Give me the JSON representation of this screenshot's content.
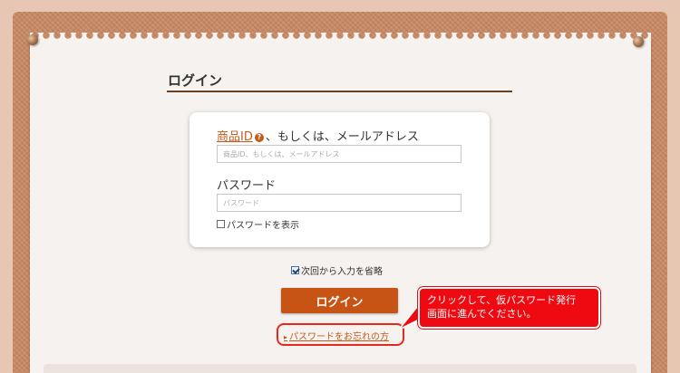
{
  "page": {
    "title": "ログイン"
  },
  "form": {
    "id_label_link": "商品ID",
    "id_help_glyph": "?",
    "id_label_rest": "、もしくは、メールアドレス",
    "id_placeholder": "商品ID、もしくは、メールアドレス",
    "password_label": "パスワード",
    "password_placeholder": "パスワード",
    "show_password_label": "パスワードを表示",
    "show_password_checked": false,
    "remember_label": "次回から入力を省略",
    "remember_checked": true,
    "login_button": "ログイン",
    "forgot_link_arrow": "▸",
    "forgot_link": "パスワードをお忘れの方"
  },
  "callout": {
    "line1": "クリックして、仮パスワード発行",
    "line2": "画面に進んでください。"
  },
  "colors": {
    "accent": "#c75414",
    "callout_red": "#ee0a10",
    "link": "#c75a1a"
  }
}
